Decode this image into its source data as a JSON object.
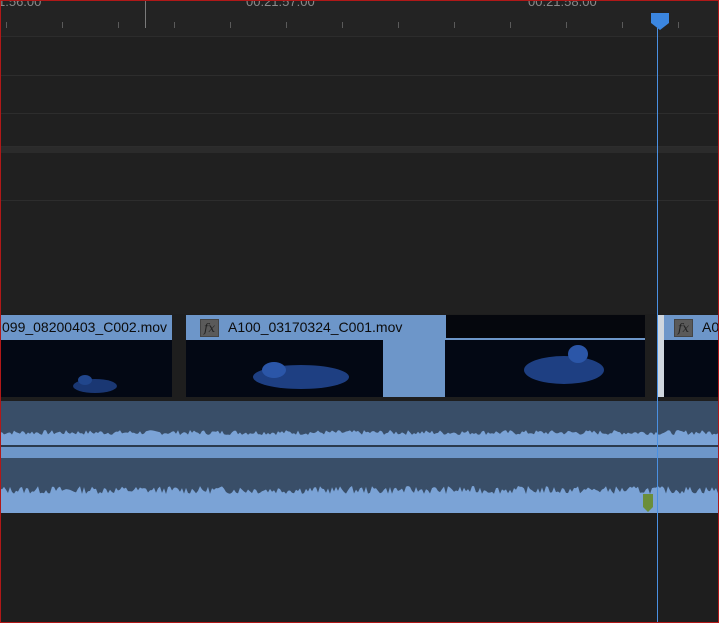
{
  "ruler": {
    "timecodes": [
      "1:56:00",
      "00:21:57:00",
      "00:21:58:00"
    ]
  },
  "clips": [
    {
      "name": "099_08200403_C002.mov",
      "fx": ""
    },
    {
      "name": "A100_03170324_C001.mov",
      "fx": "fx"
    },
    {
      "name": "A0",
      "fx": "fx"
    }
  ],
  "colors": {
    "clip_header": "#6d96c9",
    "audio_bg": "#394e68",
    "waveform": "#7ba3d6",
    "playhead": "#4a90e2",
    "marker": "#6b8e3a"
  }
}
